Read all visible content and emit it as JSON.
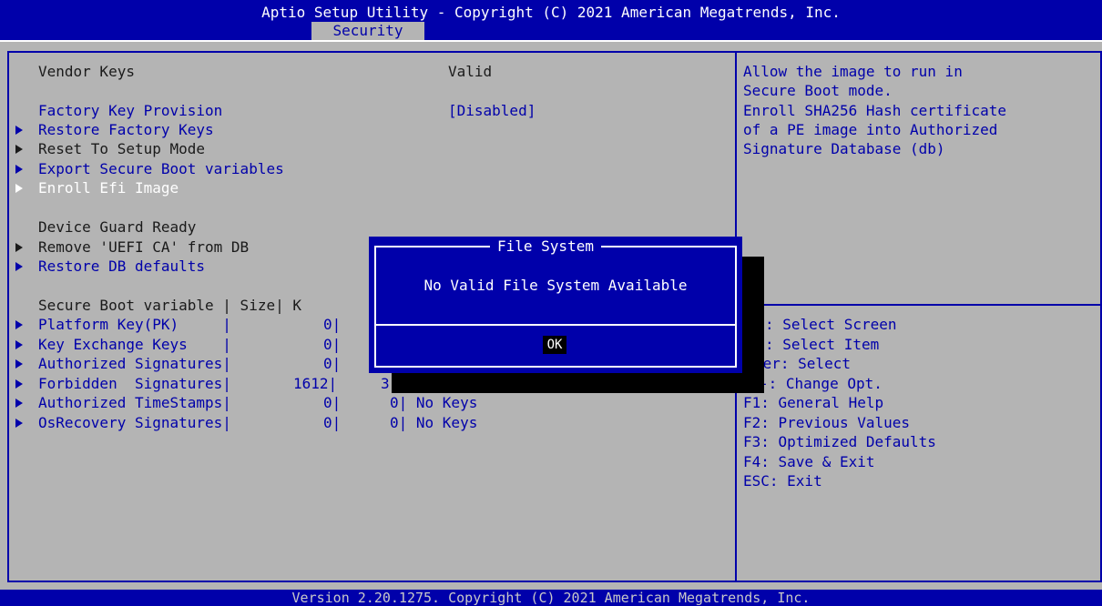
{
  "header": {
    "title": "Aptio Setup Utility - Copyright (C) 2021 American Megatrends, Inc.",
    "active_tab": "Security"
  },
  "main": {
    "vendor_keys": {
      "label": "Vendor Keys",
      "value": "Valid"
    },
    "factory_key": {
      "label": "Factory Key Provision",
      "value": "[Disabled]"
    },
    "restore_factory_keys": "Restore Factory Keys",
    "reset_setup_mode": "Reset To Setup Mode",
    "export_vars": "Export Secure Boot variables",
    "enroll_efi": "Enroll Efi Image",
    "device_guard": "Device Guard Ready",
    "remove_uefi_ca": "Remove 'UEFI CA' from DB",
    "restore_db_defaults": "Restore DB defaults",
    "table_header": "Secure Boot variable | Size| K",
    "rows": [
      {
        "name": "Platform Key(PK)     |",
        "size": "0|",
        "tail": ""
      },
      {
        "name": "Key Exchange Keys    |",
        "size": "0|",
        "tail": ""
      },
      {
        "name": "Authorized Signatures|",
        "size": "0|",
        "tail": ""
      },
      {
        "name": "Forbidden  Signatures|",
        "size": "1612|",
        "tail": "3"
      },
      {
        "name": "Authorized TimeStamps|",
        "size": "0|",
        "tail": "0| No Keys"
      },
      {
        "name": "OsRecovery Signatures|",
        "size": "0|",
        "tail": "0| No Keys"
      }
    ]
  },
  "help": {
    "lines": [
      "Allow the image to run in",
      "Secure Boot mode.",
      "Enroll SHA256 Hash certificate",
      "of a PE image into Authorized",
      "Signature Database (db)"
    ]
  },
  "keys": {
    "lines": [
      ": Select Screen",
      ": Select Item",
      "ter: Select",
      "-: Change Opt.",
      "F1: General Help",
      "F2: Previous Values",
      "F3: Optimized Defaults",
      "F4: Save & Exit",
      "ESC: Exit"
    ]
  },
  "dialog": {
    "title": "File System",
    "message": "No Valid File System Available",
    "ok_label": "OK"
  },
  "footer": {
    "text": "Version 2.20.1275. Copyright (C) 2021 American Megatrends, Inc."
  },
  "colors": {
    "background": "#b4b4b4",
    "accent_blue": "#0000aa",
    "highlight": "#ffffff"
  }
}
